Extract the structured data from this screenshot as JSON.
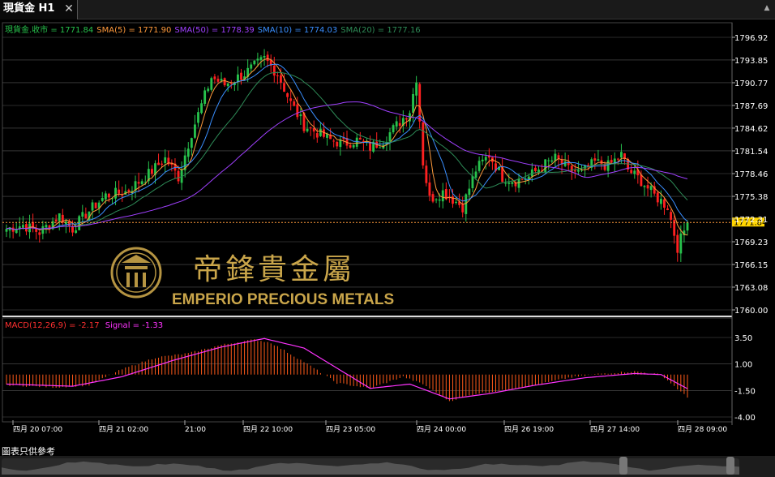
{
  "tab": {
    "title": "現貨金 H1",
    "close_glyph": "✕"
  },
  "footer_note": "圖表只供參考",
  "watermark": {
    "cn": "帝鋒貴金屬",
    "en": "EMPERIO PRECIOUS METALS"
  },
  "colors": {
    "bg": "#000000",
    "up": "#27c24c",
    "down": "#ff2020",
    "grid": "#555555",
    "current": "#ffd400",
    "sma5": "#ff9a3c",
    "sma50": "#a040ff",
    "sma10": "#3a8fff",
    "sma20": "#2e8b57",
    "macd": "#ff5a1a",
    "signal": "#ff33ff",
    "gold": "#c9a54a"
  },
  "chart_data": [
    {
      "type": "candlestick",
      "legend": [
        {
          "text": "現貨金.收市 = 1771.84",
          "color": "#27c24c"
        },
        {
          "text": "SMA(5) = 1771.90",
          "color": "#ff9a3c"
        },
        {
          "text": "SMA(50) = 1778.39",
          "color": "#a040ff"
        },
        {
          "text": "SMA(10) = 1774.03",
          "color": "#3a8fff"
        },
        {
          "text": "SMA(20) = 1777.16",
          "color": "#2e8b57"
        }
      ],
      "y_ticks": [
        "1796.92",
        "1793.85",
        "1790.77",
        "1787.69",
        "1784.62",
        "1781.54",
        "1778.46",
        "1775.38",
        "1772.31",
        "1769.23",
        "1766.15",
        "1763.08",
        "1760.00"
      ],
      "ylim": [
        1760.0,
        1796.92
      ],
      "current_price": "1771.84",
      "x_labels": [
        "四月 20 07:00",
        "四月 21 02:00",
        "21:00",
        "四月 22 10:00",
        "四月 23 05:00",
        "四月 24 00:00",
        "四月 26 19:00",
        "四月 27 14:00",
        "四月 28 09:00"
      ],
      "close_anchors": [
        [
          0,
          1771.0
        ],
        [
          5,
          1771.5
        ],
        [
          10,
          1770.5
        ],
        [
          16,
          1772.8
        ],
        [
          20,
          1771.0
        ],
        [
          24,
          1773.0
        ],
        [
          30,
          1775.5
        ],
        [
          36,
          1776.0
        ],
        [
          42,
          1778.0
        ],
        [
          48,
          1780.5
        ],
        [
          52,
          1778.0
        ],
        [
          56,
          1784.0
        ],
        [
          62,
          1791.5
        ],
        [
          66,
          1790.5
        ],
        [
          72,
          1792.0
        ],
        [
          78,
          1794.0
        ],
        [
          82,
          1792.0
        ],
        [
          86,
          1788.0
        ],
        [
          90,
          1785.0
        ],
        [
          94,
          1784.0
        ],
        [
          98,
          1783.0
        ],
        [
          102,
          1782.5
        ],
        [
          106,
          1783.0
        ],
        [
          110,
          1782.0
        ],
        [
          114,
          1783.0
        ],
        [
          118,
          1785.0
        ],
        [
          122,
          1787.0
        ],
        [
          124,
          1791.5
        ],
        [
          126,
          1780.0
        ],
        [
          128,
          1775.0
        ],
        [
          132,
          1776.0
        ],
        [
          138,
          1774.0
        ],
        [
          142,
          1779.0
        ],
        [
          146,
          1781.0
        ],
        [
          150,
          1778.0
        ],
        [
          154,
          1777.5
        ],
        [
          158,
          1778.0
        ],
        [
          162,
          1779.5
        ],
        [
          166,
          1780.5
        ],
        [
          170,
          1779.0
        ],
        [
          174,
          1778.5
        ],
        [
          178,
          1780.0
        ],
        [
          182,
          1779.5
        ],
        [
          186,
          1781.0
        ],
        [
          188,
          1779.0
        ],
        [
          192,
          1777.5
        ],
        [
          196,
          1775.5
        ],
        [
          200,
          1774.0
        ],
        [
          203,
          1768.5
        ],
        [
          206,
          1771.84
        ]
      ]
    },
    {
      "type": "histogram",
      "title": "MACD(12,26,9) = -2.17",
      "title_color": "#ff3030",
      "signal_label": "Signal = -1.33",
      "signal_color": "#ff33ff",
      "y_ticks": [
        "3.50",
        "1.00",
        "-1.50",
        "-4.00"
      ],
      "ylim": [
        -4.0,
        3.5
      ],
      "macd_anchors": [
        [
          0,
          -1.0
        ],
        [
          15,
          -1.2
        ],
        [
          25,
          -1.0
        ],
        [
          35,
          0.5
        ],
        [
          45,
          1.6
        ],
        [
          55,
          2.0
        ],
        [
          65,
          2.8
        ],
        [
          75,
          3.3
        ],
        [
          80,
          3.0
        ],
        [
          90,
          1.2
        ],
        [
          100,
          -0.8
        ],
        [
          110,
          -1.3
        ],
        [
          120,
          -0.2
        ],
        [
          126,
          -0.9
        ],
        [
          134,
          -2.5
        ],
        [
          142,
          -1.8
        ],
        [
          150,
          -1.5
        ],
        [
          160,
          -1.0
        ],
        [
          170,
          -0.3
        ],
        [
          180,
          0.1
        ],
        [
          190,
          0.3
        ],
        [
          198,
          0.0
        ],
        [
          206,
          -2.17
        ]
      ],
      "signal_anchors": [
        [
          0,
          -0.9
        ],
        [
          20,
          -1.1
        ],
        [
          35,
          -0.2
        ],
        [
          50,
          1.3
        ],
        [
          65,
          2.6
        ],
        [
          78,
          3.4
        ],
        [
          90,
          2.5
        ],
        [
          100,
          0.6
        ],
        [
          110,
          -1.3
        ],
        [
          122,
          -0.9
        ],
        [
          134,
          -2.3
        ],
        [
          146,
          -1.8
        ],
        [
          160,
          -1.0
        ],
        [
          175,
          -0.3
        ],
        [
          190,
          0.1
        ],
        [
          198,
          0.0
        ],
        [
          206,
          -1.33
        ]
      ]
    }
  ]
}
